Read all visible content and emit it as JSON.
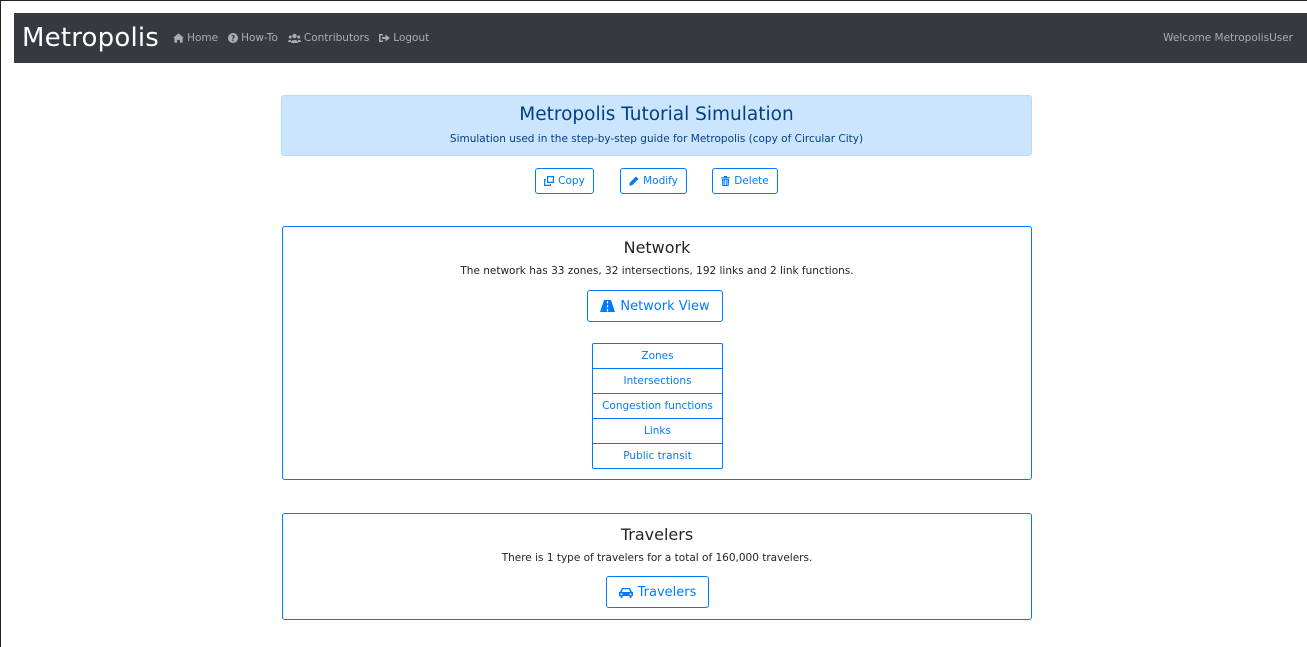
{
  "navbar": {
    "brand": "Metropolis",
    "items": [
      {
        "label": "Home",
        "icon": "home-icon"
      },
      {
        "label": "How-To",
        "icon": "question-circle-icon"
      },
      {
        "label": "Contributors",
        "icon": "users-icon"
      },
      {
        "label": "Logout",
        "icon": "sign-out-icon"
      }
    ],
    "welcome": "Welcome MetropolisUser"
  },
  "header": {
    "title": "Metropolis Tutorial Simulation",
    "subtitle": "Simulation used in the step-by-step guide for Metropolis (copy of Circular City)"
  },
  "actions": {
    "copy_label": "Copy",
    "modify_label": "Modify",
    "delete_label": "Delete"
  },
  "network": {
    "title": "Network",
    "description": "The network has 33 zones, 32 intersections, 192 links and 2 link functions.",
    "view_button": "Network View",
    "list": [
      "Zones",
      "Intersections",
      "Congestion functions",
      "Links",
      "Public transit"
    ]
  },
  "travelers": {
    "title": "Travelers",
    "description": "There is 1 type of travelers for a total of 160,000 travelers.",
    "button": "Travelers"
  },
  "colors": {
    "navbar_bg": "#343a40",
    "primary": "#007bff",
    "alert_bg": "#cce5ff",
    "alert_text": "#004085"
  }
}
